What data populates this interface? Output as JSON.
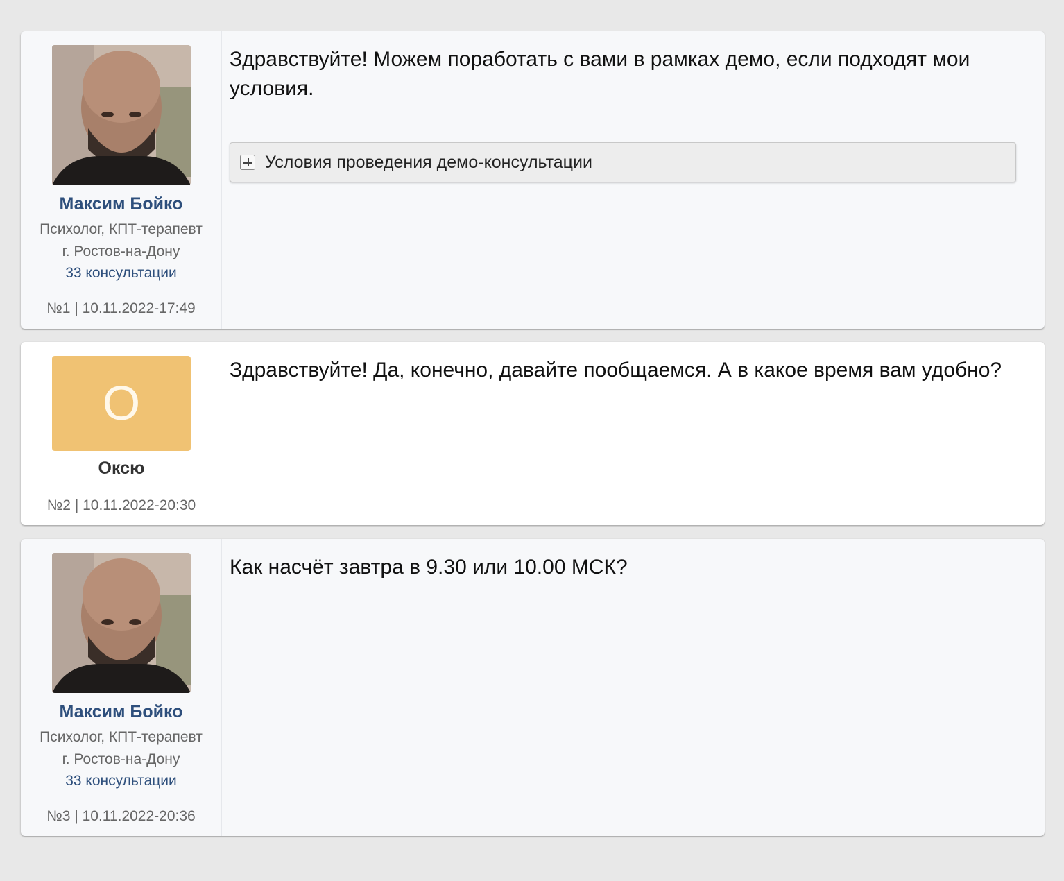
{
  "posts": [
    {
      "author": "Максим Бойко",
      "role": "Психолог, КПТ-терапевт",
      "city": "г. Ростов-на-Дону",
      "consultations": "33 консультации",
      "info": "№1 | 10.11.2022-17:49",
      "text": "Здравствуйте! Можем поработать с вами в рамках демо, если подходят мои условия.",
      "spoiler": "Условия проведения демо-консультации"
    },
    {
      "author": "Оксю",
      "avatar_letter": "О",
      "avatar_color": "#f0c273",
      "info": "№2 | 10.11.2022-20:30",
      "text": "Здравствуйте! Да, конечно, давайте пообщаемся. А в какое время вам удобно?"
    },
    {
      "author": "Максим Бойко",
      "role": "Психолог, КПТ-терапевт",
      "city": "г. Ростов-на-Дону",
      "consultations": "33 консультации",
      "info": "№3 | 10.11.2022-20:36",
      "text": "Как насчёт завтра в 9.30 или 10.00 МСК?"
    }
  ],
  "colors": {
    "author_link": "#2e4f7c",
    "page_background": "#e8e8e8"
  }
}
